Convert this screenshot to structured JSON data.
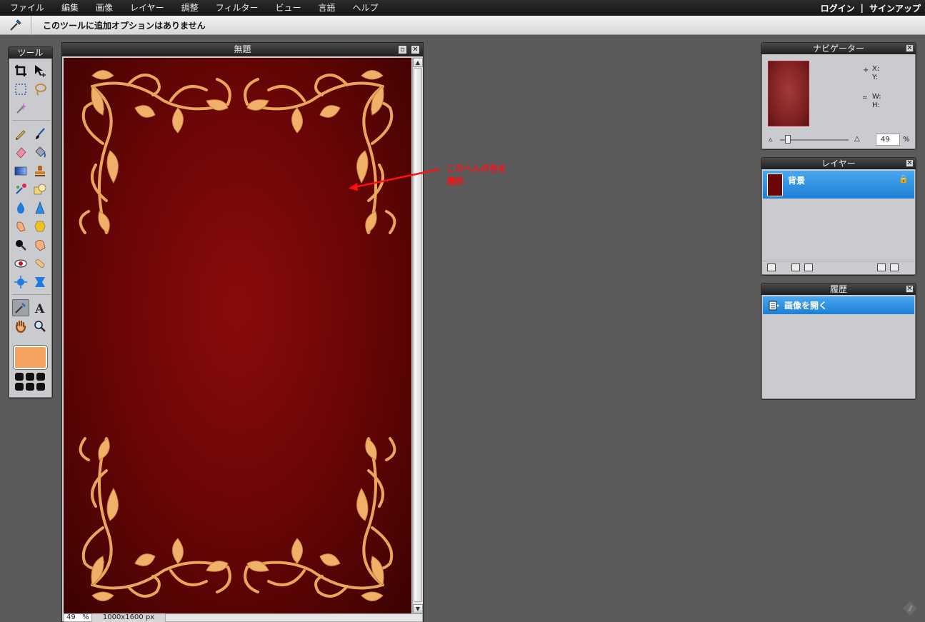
{
  "menu": [
    "ファイル",
    "編集",
    "画像",
    "レイヤー",
    "調整",
    "フィルター",
    "ビュー",
    "言語",
    "ヘルプ"
  ],
  "account": {
    "login": "ログイン",
    "separator": "|",
    "signup": "サインアップ"
  },
  "options_bar": {
    "message": "このツールに追加オプションはありません"
  },
  "toolbox": {
    "title": "ツール",
    "foreground_color": "#f4a460"
  },
  "document": {
    "title": "無題",
    "zoom": "49",
    "zoom_unit": "%",
    "size": "1000x1600 px"
  },
  "annotation": {
    "line1": "このへんの色を",
    "line2": "選択",
    "color": "#ff1010"
  },
  "navigator": {
    "title": "ナビゲーター",
    "x_label": "X:",
    "y_label": "Y:",
    "w_label": "W:",
    "h_label": "H:",
    "zoom": "49",
    "zoom_unit": "%"
  },
  "layers": {
    "title": "レイヤー",
    "items": [
      {
        "name": "背景",
        "locked": true
      }
    ]
  },
  "history": {
    "title": "履歴",
    "items": [
      "画像を開く"
    ]
  }
}
